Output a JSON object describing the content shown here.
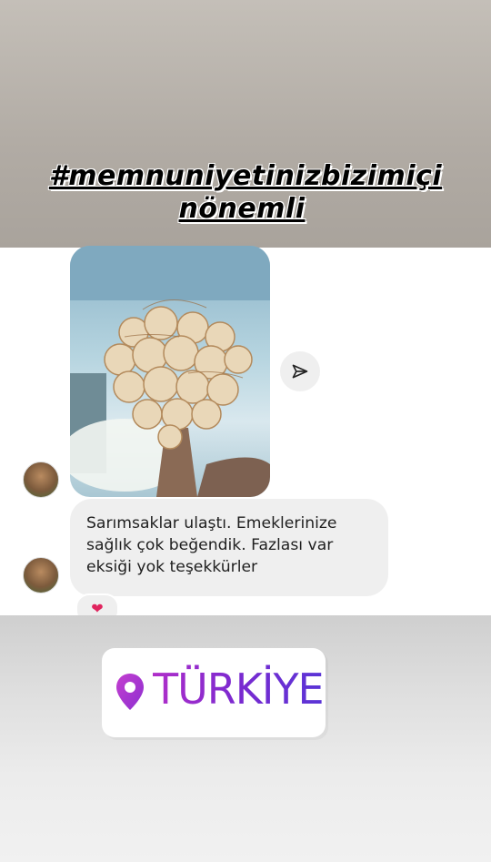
{
  "story": {
    "hashtag_line1": "#memnuniyetinizbizimiçi",
    "hashtag_line2": "nönemli"
  },
  "chat": {
    "message_lines": [
      "Sarımsaklar ulaştı. Emeklerinize",
      "sağlık çok beğendik. Fazlası var",
      "eksiği yok teşekkürler"
    ],
    "reaction": "❤"
  },
  "location_sticker": {
    "label": "TÜRKİYE",
    "colors": {
      "start": "#b02ec9",
      "end": "#5a35d6"
    }
  },
  "icons": {
    "share": "send-icon",
    "pin": "map-pin-icon"
  }
}
